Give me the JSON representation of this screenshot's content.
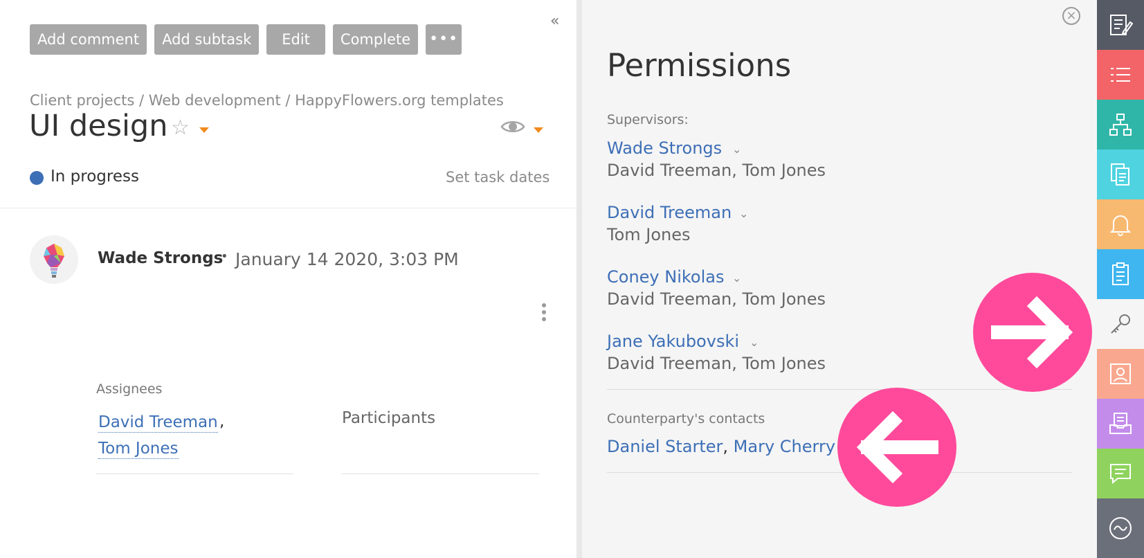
{
  "toolbar": {
    "add_comment": "Add comment",
    "add_subtask": "Add subtask",
    "edit": "Edit",
    "complete": "Complete",
    "more": "•••"
  },
  "collapse_icon": "«",
  "breadcrumb": "Client projects / Web development / HappyFlowers.org templates",
  "task": {
    "title": "UI design",
    "status": "In progress",
    "status_color": "#3d6fb6",
    "set_dates": "Set task dates"
  },
  "comment": {
    "author": "Wade Strongs",
    "bullet": "•",
    "date": "January 14 2020, 3:03 PM"
  },
  "assignees": {
    "label": "Assignees",
    "people": [
      "David Treeman",
      "Tom Jones"
    ],
    "comma": ","
  },
  "participants": {
    "label": "Participants"
  },
  "permissions": {
    "close": "×",
    "title": "Permissions",
    "supervisors_label": "Supervisors:",
    "supervisors": [
      {
        "name": "Wade Strongs",
        "subordinates": "David Treeman, Tom Jones"
      },
      {
        "name": "David Treeman",
        "subordinates": "Tom Jones"
      },
      {
        "name": "Coney Nikolas",
        "subordinates": "David Treeman, Tom Jones"
      },
      {
        "name": "Jane Yakubovski",
        "subordinates": "David Treeman, Tom Jones"
      }
    ],
    "counterparty_label": "Counterparty's contacts",
    "counterparty_contacts": [
      "Daniel Starter",
      "Mary Cherry"
    ],
    "contact_sep": ", "
  },
  "sidebar": [
    {
      "icon": "edit-document-icon",
      "color": "#555a65"
    },
    {
      "icon": "list-icon",
      "color": "#f26468"
    },
    {
      "icon": "hierarchy-icon",
      "color": "#2fb6a8"
    },
    {
      "icon": "documents-icon",
      "color": "#4fd3e0"
    },
    {
      "icon": "bell-icon",
      "color": "#f7b870"
    },
    {
      "icon": "clipboard-icon",
      "color": "#3fb6ef"
    },
    {
      "icon": "key-icon",
      "color": "#f5f5f5"
    },
    {
      "icon": "contact-card-icon",
      "color": "#f9a88f"
    },
    {
      "icon": "inbox-icon",
      "color": "#c38ceb"
    },
    {
      "icon": "chat-icon",
      "color": "#8fd35e"
    },
    {
      "icon": "activity-icon",
      "color": "#6a6f79"
    }
  ],
  "accent_color": "#ff4a9b"
}
